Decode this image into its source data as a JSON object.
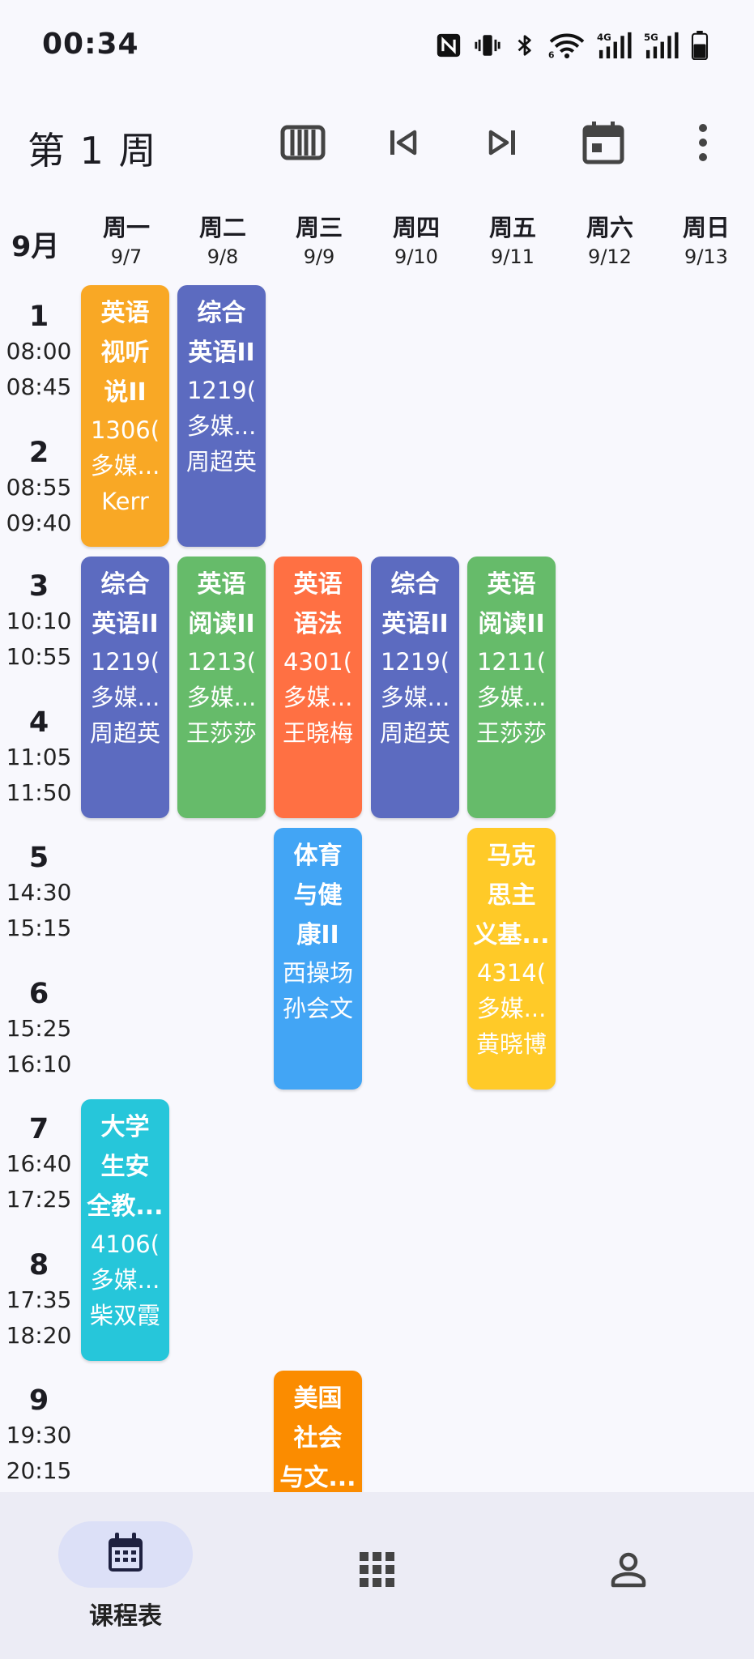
{
  "status": {
    "time": "00:34"
  },
  "toolbar": {
    "title": "第 1 周"
  },
  "header": {
    "month": "9月",
    "days": [
      {
        "name": "周一",
        "date": "9/7"
      },
      {
        "name": "周二",
        "date": "9/8"
      },
      {
        "name": "周三",
        "date": "9/9"
      },
      {
        "name": "周四",
        "date": "9/10"
      },
      {
        "name": "周五",
        "date": "9/11"
      },
      {
        "name": "周六",
        "date": "9/12"
      },
      {
        "name": "周日",
        "date": "9/13"
      }
    ]
  },
  "slots": [
    {
      "num": "1",
      "start": "08:00",
      "end": "08:45"
    },
    {
      "num": "2",
      "start": "08:55",
      "end": "09:40"
    },
    {
      "num": "3",
      "start": "10:10",
      "end": "10:55"
    },
    {
      "num": "4",
      "start": "11:05",
      "end": "11:50"
    },
    {
      "num": "5",
      "start": "14:30",
      "end": "15:15"
    },
    {
      "num": "6",
      "start": "15:25",
      "end": "16:10"
    },
    {
      "num": "7",
      "start": "16:40",
      "end": "17:25"
    },
    {
      "num": "8",
      "start": "17:35",
      "end": "18:20"
    },
    {
      "num": "9",
      "start": "19:30",
      "end": "20:15"
    }
  ],
  "courses": [
    {
      "day": 1,
      "start": 1,
      "span": 2,
      "color": "#F9A825",
      "name": [
        "英语",
        "视听",
        "说II"
      ],
      "room": [
        "1306(",
        "多媒..."
      ],
      "teacher": "Kerr"
    },
    {
      "day": 2,
      "start": 1,
      "span": 2,
      "color": "#5C6BC0",
      "name": [
        "综合",
        "英语II"
      ],
      "room": [
        "1219(",
        "多媒..."
      ],
      "teacher": "周超英"
    },
    {
      "day": 1,
      "start": 3,
      "span": 2,
      "color": "#5C6BC0",
      "name": [
        "综合",
        "英语II"
      ],
      "room": [
        "1219(",
        "多媒..."
      ],
      "teacher": "周超英"
    },
    {
      "day": 2,
      "start": 3,
      "span": 2,
      "color": "#66BB6A",
      "name": [
        "英语",
        "阅读II"
      ],
      "room": [
        "1213(",
        "多媒..."
      ],
      "teacher": "王莎莎"
    },
    {
      "day": 3,
      "start": 3,
      "span": 2,
      "color": "#FF7043",
      "name": [
        "英语",
        "语法"
      ],
      "room": [
        "4301(",
        "多媒..."
      ],
      "teacher": "王晓梅"
    },
    {
      "day": 4,
      "start": 3,
      "span": 2,
      "color": "#5C6BC0",
      "name": [
        "综合",
        "英语II"
      ],
      "room": [
        "1219(",
        "多媒..."
      ],
      "teacher": "周超英"
    },
    {
      "day": 5,
      "start": 3,
      "span": 2,
      "color": "#66BB6A",
      "name": [
        "英语",
        "阅读II"
      ],
      "room": [
        "1211(",
        "多媒..."
      ],
      "teacher": "王莎莎"
    },
    {
      "day": 3,
      "start": 5,
      "span": 2,
      "color": "#42A5F5",
      "name": [
        "体育",
        "与健",
        "康II"
      ],
      "room": [
        "西操场"
      ],
      "teacher": "孙会文"
    },
    {
      "day": 5,
      "start": 5,
      "span": 2,
      "color": "#FFCA28",
      "name": [
        "马克",
        "思主",
        "义基..."
      ],
      "room": [
        "4314(",
        "多媒..."
      ],
      "teacher": "黄晓博"
    },
    {
      "day": 1,
      "start": 7,
      "span": 2,
      "color": "#26C6DA",
      "name": [
        "大学",
        "生安",
        "全教..."
      ],
      "room": [
        "4106(",
        "多媒..."
      ],
      "teacher": "柴双霞"
    },
    {
      "day": 3,
      "start": 9,
      "span": 2,
      "color": "#FB8C00",
      "name": [
        "美国",
        "社会",
        "与文..."
      ],
      "room": [],
      "teacher": ""
    }
  ],
  "nav": {
    "schedule_label": "课程表",
    "items": [
      {
        "icon": "calendar-icon"
      },
      {
        "icon": "apps-grid-icon"
      },
      {
        "icon": "person-icon"
      }
    ]
  },
  "icons": {
    "toolbar": [
      "week-view-icon",
      "skip-previous-icon",
      "skip-next-icon",
      "calendar-today-icon",
      "more-vert-icon"
    ],
    "status": [
      "nfc-icon",
      "vibrate-icon",
      "bluetooth-icon",
      "wifi-icon",
      "signal-4g-icon",
      "signal-5g-icon",
      "battery-icon"
    ]
  }
}
